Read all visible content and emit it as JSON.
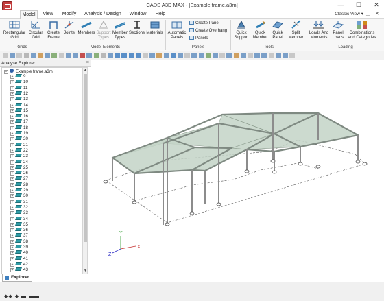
{
  "window": {
    "title": "CADS A3D MAX - [Example frame.a3m]",
    "minimize": "—",
    "maximize": "☐",
    "close": "✕"
  },
  "menu": {
    "tabs": [
      "Model",
      "View",
      "Modify",
      "Analysis / Design",
      "Window",
      "Help"
    ],
    "active": "Model",
    "classic_view": "Classic View",
    "classic_view_arrow": "▾",
    "doc_minimize": "▁",
    "doc_close": "✕"
  },
  "ribbon": {
    "buttons": {
      "rect_grid": "Rectangular Grid",
      "circ_grid": "Circular Grid",
      "create_frame": "Create Frame",
      "joints": "Joints",
      "members": "Members",
      "support_types": "Support Types",
      "member_types": "Member Types",
      "sections": "Sections",
      "materials": "Materials",
      "auto_panels": "Automatic Panels",
      "create_panel": "Create Panel",
      "create_overhang": "Create Overhang",
      "panels": "Panels",
      "quick_support": "Quick Support",
      "quick_member": "Quick Member",
      "quick_panel": "Quick Panel",
      "split_member": "Split Member",
      "loads_moments": "Loads And Moments",
      "panel_loads": "Panel Loads",
      "combinations": "Combinations and Categories"
    },
    "groups": {
      "grids": "Grids",
      "model_elements": "Model Elements",
      "panels": "Panels",
      "tools": "Tools",
      "loading": "Loading"
    }
  },
  "explorer": {
    "title": "Analyse Explorer",
    "close": "×",
    "root": "Example frame.a3m",
    "items": [
      "9",
      "10",
      "11",
      "12",
      "13",
      "14",
      "15",
      "16",
      "17",
      "18",
      "19",
      "20",
      "21",
      "22",
      "23",
      "24",
      "25",
      "26",
      "27",
      "28",
      "29",
      "30",
      "31",
      "32",
      "33",
      "34",
      "35",
      "36",
      "37",
      "38",
      "39",
      "40",
      "41",
      "42",
      "43"
    ],
    "tab_label": "Explorer"
  },
  "axes": {
    "x": "X",
    "y": "Y",
    "z": "Z"
  },
  "status": {
    "text": "◆◆  ◆   ▬  ▬▬"
  },
  "colors": {
    "panel_fill": "#c3d4c7",
    "member": "#9a9a9a",
    "beam_icon": "#2f9ca6"
  }
}
